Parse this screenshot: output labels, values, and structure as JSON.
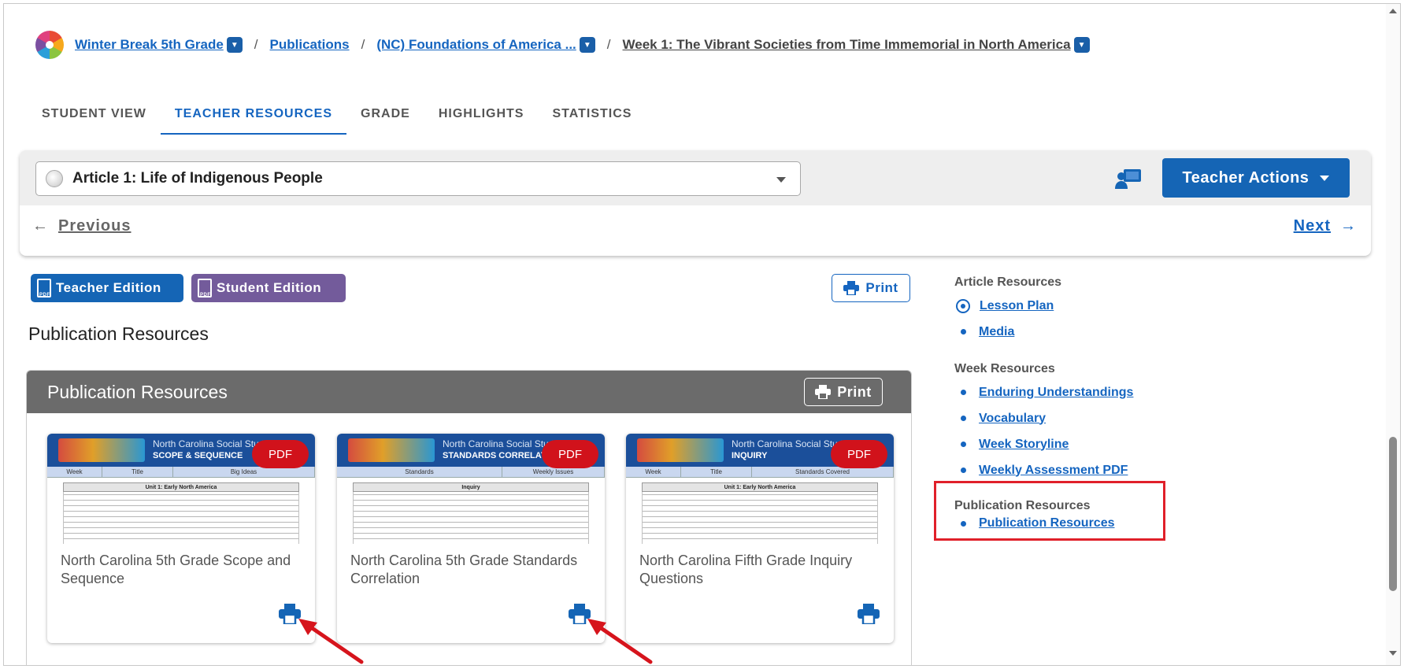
{
  "breadcrumb": {
    "items": [
      {
        "label": "Winter Break 5th Grade",
        "has_caret": true
      },
      {
        "label": "Publications",
        "has_caret": false
      },
      {
        "label": "(NC) Foundations of America ...",
        "has_caret": true
      },
      {
        "label": "Week 1: The Vibrant Societies from Time Immemorial in North America",
        "has_caret": true
      }
    ],
    "separator": "/"
  },
  "tabs": [
    {
      "label": "STUDENT VIEW",
      "active": false
    },
    {
      "label": "TEACHER RESOURCES",
      "active": true
    },
    {
      "label": "GRADE",
      "active": false
    },
    {
      "label": "HIGHLIGHTS",
      "active": false
    },
    {
      "label": "STATISTICS",
      "active": false
    }
  ],
  "article_panel": {
    "selected_article": "Article 1: Life of Indigenous People",
    "teacher_actions_label": "Teacher Actions",
    "previous_label": "Previous",
    "next_label": "Next"
  },
  "toolbar": {
    "teacher_edition_label": "Teacher Edition",
    "student_edition_label": "Student Edition",
    "print_label": "Print"
  },
  "main": {
    "section_title": "Publication Resources",
    "box_title": "Publication Resources",
    "box_print_label": "Print",
    "cards": [
      {
        "title": "North Carolina 5th Grade Scope and Sequence",
        "badge": "PDF",
        "thumb_title": "North Carolina Social Stud",
        "thumb_sub": "SCOPE & SEQUENCE",
        "cols": [
          "Week",
          "Title",
          "Big Ideas"
        ],
        "row": "Unit 1: Early North America"
      },
      {
        "title": "North Carolina 5th Grade Standards Correlation",
        "badge": "PDF",
        "thumb_title": "North Carolina Social Stud",
        "thumb_sub": "STANDARDS CORRELATI",
        "cols": [
          "Standards",
          "Weekly Issues"
        ],
        "row": "Inquiry"
      },
      {
        "title": "North Carolina Fifth Grade Inquiry Questions",
        "badge": "PDF",
        "thumb_title": "North Carolina Social Stud",
        "thumb_sub": "INQUIRY",
        "cols": [
          "Week",
          "Title",
          "Standards Covered"
        ],
        "row": "Unit 1: Early North America"
      }
    ]
  },
  "sidebar": {
    "article_resources": {
      "heading": "Article Resources",
      "items": [
        {
          "label": "Lesson Plan",
          "selected": true
        },
        {
          "label": "Media",
          "selected": false
        }
      ]
    },
    "week_resources": {
      "heading": "Week Resources",
      "items": [
        {
          "label": "Enduring Understandings"
        },
        {
          "label": "Vocabulary"
        },
        {
          "label": "Week Storyline"
        },
        {
          "label": "Weekly Assessment PDF"
        }
      ]
    },
    "publication_resources": {
      "heading": "Publication Resources",
      "items": [
        {
          "label": "Publication Resources"
        }
      ]
    }
  },
  "colors": {
    "primary": "#1565b5",
    "student_edition": "#735b9b",
    "pdf_badge": "#d1121b",
    "highlight": "#e0202a",
    "header_gray": "#6b6b6b"
  }
}
